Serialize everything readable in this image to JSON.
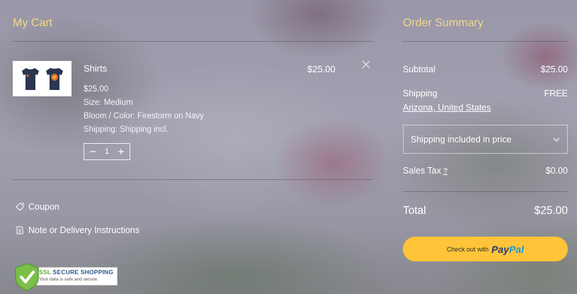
{
  "cart": {
    "title": "My Cart",
    "item": {
      "name": "Shirts",
      "total": "$25.00",
      "price": "$25.00",
      "size": "Size: Medium",
      "color": "Bloom / Color: Firestorm on Navy",
      "shipping": "Shipping: Shipping incl.",
      "quantity": "1"
    },
    "coupon_label": "Coupon",
    "note_label": "Note or Delivery Instructions",
    "ssl": {
      "line1_prefix": "SSL",
      "line1_rest": "SECURE SHOPPING",
      "line2": "Your data is safe and secure."
    }
  },
  "summary": {
    "title": "Order Summary",
    "subtotal_label": "Subtotal",
    "subtotal_value": "$25.00",
    "shipping_label": "Shipping",
    "shipping_value": "FREE",
    "shipping_location": "Arizona, United States",
    "shipping_option": "Shipping included in price",
    "tax_label": "Sales Tax",
    "tax_help": "?",
    "tax_value": "$0.00",
    "total_label": "Total",
    "total_value": "$25.00",
    "checkout_prefix": "Check out with",
    "paypal_pay": "Pay",
    "paypal_pal": "Pal"
  },
  "colors": {
    "heading": "#f3d98a",
    "paypal_button": "#ffc439",
    "paypal_dark": "#253b80",
    "paypal_light": "#179bd7"
  }
}
